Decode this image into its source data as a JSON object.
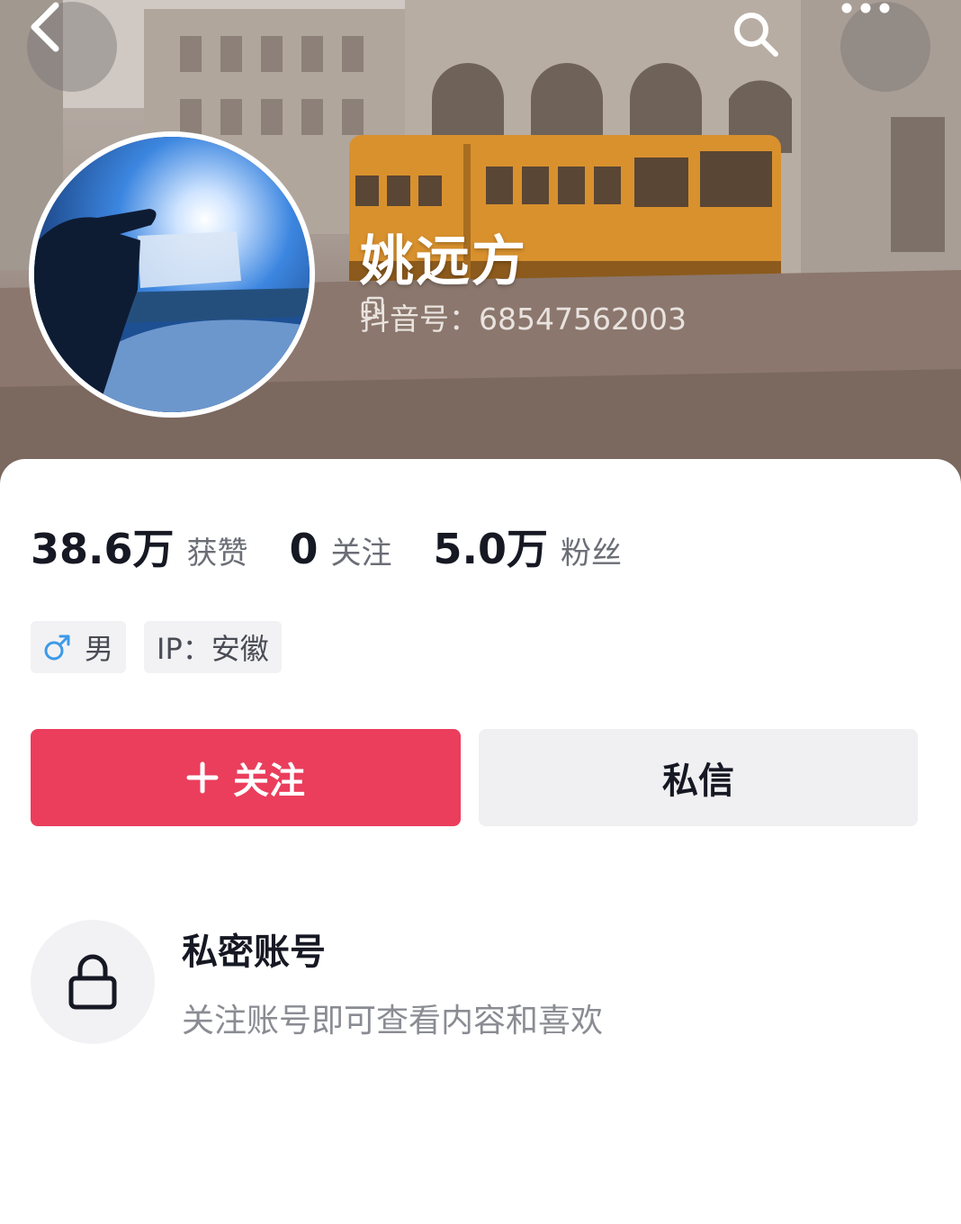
{
  "header": {
    "nickname": "姚远方",
    "douyin_id": "抖音号：68547562003"
  },
  "stats": [
    {
      "value": "38.6万",
      "label": "获赞"
    },
    {
      "value": "0",
      "label": "关注"
    },
    {
      "value": "5.0万",
      "label": "粉丝"
    }
  ],
  "tags": {
    "gender": "男",
    "ip": "IP：安徽"
  },
  "actions": {
    "follow_label": "关注",
    "message_label": "私信"
  },
  "private_account": {
    "title": "私密账号",
    "description": "关注账号即可查看内容和喜欢"
  },
  "colors": {
    "accent": "#ea3e5c",
    "text_primary": "#161823",
    "text_secondary": "#6b6e76",
    "chip_bg": "#f2f2f4",
    "male_blue": "#3d9ae8"
  },
  "icons": [
    "back-arrow-icon",
    "search-icon",
    "more-icon",
    "copy-icon",
    "male-icon",
    "plus-icon",
    "lock-icon"
  ]
}
